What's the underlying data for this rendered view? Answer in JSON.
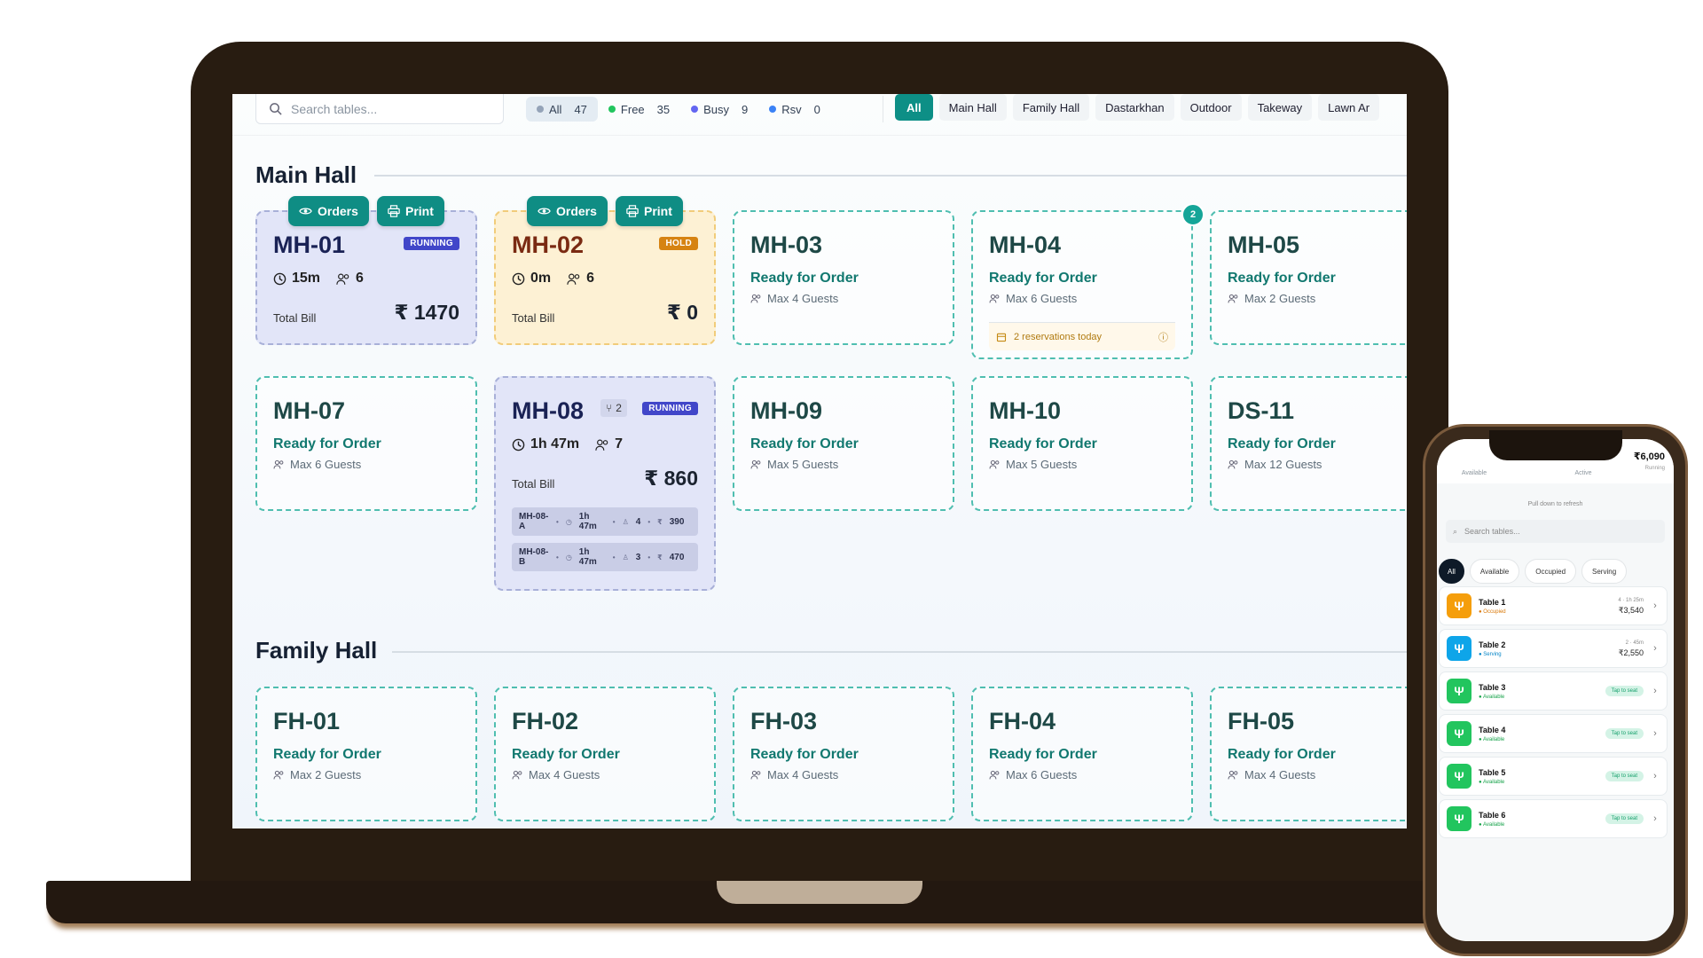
{
  "toolbar": {
    "search_placeholder": "Search tables...",
    "stats": [
      {
        "label": "All",
        "count": "47",
        "color": "#94a3b8"
      },
      {
        "label": "Free",
        "count": "35",
        "color": "#22c55e"
      },
      {
        "label": "Busy",
        "count": "9",
        "color": "#6366f1"
      },
      {
        "label": "Rsv",
        "count": "0",
        "color": "#3b82f6"
      }
    ],
    "areas": [
      "All",
      "Main Hall",
      "Family Hall",
      "Dastarkhan",
      "Outdoor",
      "Takeway",
      "Lawn Ar"
    ]
  },
  "main_hall": {
    "title": "Main Hall",
    "mh01": {
      "code": "MH-01",
      "status": "RUNNING",
      "time": "15m",
      "guests": "6",
      "bill_label": "Total Bill",
      "bill": "₹ 1470",
      "orders": "Orders",
      "print": "Print"
    },
    "mh02": {
      "code": "MH-02",
      "status": "HOLD",
      "time": "0m",
      "guests": "6",
      "bill_label": "Total Bill",
      "bill": "₹ 0",
      "orders": "Orders",
      "print": "Print"
    },
    "mh03": {
      "code": "MH-03",
      "ready": "Ready for Order",
      "guests": "Max 4 Guests"
    },
    "mh04": {
      "code": "MH-04",
      "ready": "Ready for Order",
      "guests": "Max 6 Guests",
      "badge": "2",
      "reservations": "2 reservations today"
    },
    "mh05": {
      "code": "MH-05",
      "ready": "Ready for Order",
      "guests": "Max 2 Guests"
    },
    "mh07": {
      "code": "MH-07",
      "ready": "Ready for Order",
      "guests": "Max 6 Guests"
    },
    "mh08": {
      "code": "MH-08",
      "split": "2",
      "status": "RUNNING",
      "time": "1h 47m",
      "guests": "7",
      "bill_label": "Total Bill",
      "bill": "₹ 860",
      "subs": [
        {
          "label": "MH-08-A",
          "time": "1h 47m",
          "guests": "4",
          "amount": "390"
        },
        {
          "label": "MH-08-B",
          "time": "1h 47m",
          "guests": "3",
          "amount": "470"
        }
      ]
    },
    "mh09": {
      "code": "MH-09",
      "ready": "Ready for Order",
      "guests": "Max 5 Guests"
    },
    "mh10": {
      "code": "MH-10",
      "ready": "Ready for Order",
      "guests": "Max 5 Guests"
    },
    "ds11": {
      "code": "DS-11",
      "ready": "Ready for Order",
      "guests": "Max 12 Guests"
    }
  },
  "family_hall": {
    "title": "Family Hall",
    "fh01": {
      "code": "FH-01",
      "ready": "Ready for Order",
      "guests": "Max 2 Guests"
    },
    "fh02": {
      "code": "FH-02",
      "ready": "Ready for Order",
      "guests": "Max 4 Guests"
    },
    "fh03": {
      "code": "FH-03",
      "ready": "Ready for Order",
      "guests": "Max 4 Guests"
    },
    "fh04": {
      "code": "FH-04",
      "ready": "Ready for Order",
      "guests": "Max 6 Guests"
    },
    "fh05": {
      "code": "FH-05",
      "ready": "Ready for Order",
      "guests": "Max 4 Guests"
    }
  },
  "phone": {
    "stat_labels": [
      "Available",
      "Active"
    ],
    "total": "₹6,090",
    "total_label": "Running",
    "pull": "Pull down to refresh",
    "search_placeholder": "Search tables...",
    "filters": [
      "All",
      "Available",
      "Occupied",
      "Serving"
    ],
    "tables": [
      {
        "name": "Table 1",
        "status": "Occupied",
        "meta": "4 · 1h 25m",
        "amount": "₹3,540",
        "color": "#f59e0b"
      },
      {
        "name": "Table 2",
        "status": "Serving",
        "meta": "2 · 45m",
        "amount": "₹2,550",
        "color": "#0ea5e9"
      },
      {
        "name": "Table 3",
        "status": "Available",
        "action": "Tap to seat",
        "color": "#22c55e"
      },
      {
        "name": "Table 4",
        "status": "Available",
        "action": "Tap to seat",
        "color": "#22c55e"
      },
      {
        "name": "Table 5",
        "status": "Available",
        "action": "Tap to seat",
        "color": "#22c55e"
      },
      {
        "name": "Table 6",
        "status": "Available",
        "action": "Tap to seat",
        "color": "#22c55e"
      }
    ]
  }
}
